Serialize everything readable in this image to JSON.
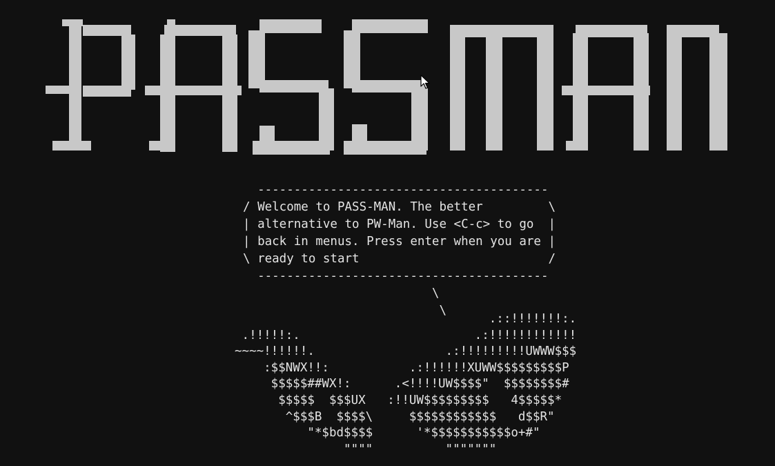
{
  "terminal": {
    "banner_text": "PASSMAN",
    "speech_bubble": [
      "  ----------------------------------------",
      "/ Welcome to PASS-MAN. The better         \\",
      "| alternative to PW-Man. Use <C-c> to go  |",
      "| back in menus. Press enter when you are |",
      "\\ ready to start                          /",
      "  ----------------------------------------",
      "                          \\",
      "                           \\"
    ],
    "ascii_art": [
      "                                   .::!!!!!!!:.",
      " .!!!!!:.                        .:!!!!!!!!!!!!",
      "~~~~!!!!!!.                  .:!!!!!!!!!UWWW$$$",
      "    :$$NWX!!:           .:!!!!!!XUWW$$$$$$$$$P",
      "     $$$$$##WX!:      .<!!!!UW$$$$\"  $$$$$$$$#",
      "      $$$$$  $$$UX   :!!UW$$$$$$$$$   4$$$$$*",
      "       ^$$$B  $$$$\\     $$$$$$$$$$$$   d$$R\"",
      "          \"*$bd$$$$      '*$$$$$$$$$$$o+#\"",
      "               \"\"\"\"          \"\"\"\"\"\"\""
    ]
  }
}
